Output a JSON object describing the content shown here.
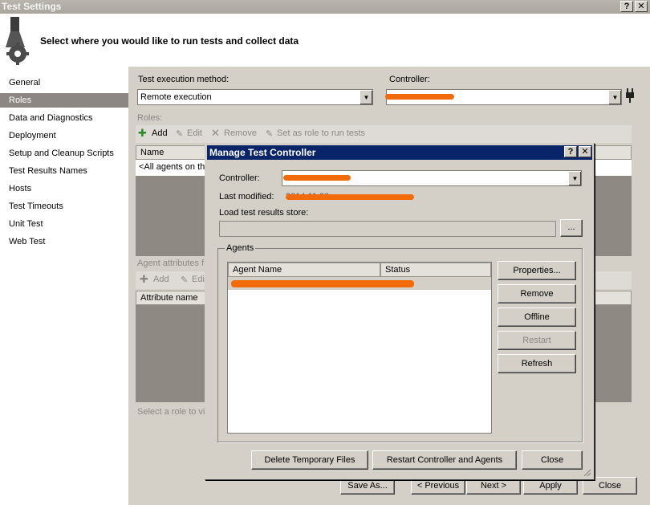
{
  "window": {
    "title": "Test Settings",
    "help_btn": "?",
    "close_btn": "✕",
    "header_text": "Select where you would like to run tests and collect data"
  },
  "sidebar": {
    "items": [
      {
        "label": "General"
      },
      {
        "label": "Roles"
      },
      {
        "label": "Data and Diagnostics"
      },
      {
        "label": "Deployment"
      },
      {
        "label": "Setup and Cleanup Scripts"
      },
      {
        "label": "Test Results Names"
      },
      {
        "label": "Hosts"
      },
      {
        "label": "Test Timeouts"
      },
      {
        "label": "Unit Test"
      },
      {
        "label": "Web Test"
      }
    ],
    "selected": "Roles"
  },
  "main": {
    "exec_method_label": "Test execution method:",
    "exec_method_value": "Remote execution",
    "controller_label": "Controller:",
    "controller_value": "",
    "roles_label": "Roles:",
    "roles_toolbar": {
      "add": "Add",
      "edit": "Edit",
      "remove": "Remove",
      "set_role": "Set as role to run tests"
    },
    "roles_grid_header": "Name",
    "roles_row": "<All agents on th",
    "agent_attr_label": "Agent attributes f",
    "attr_toolbar": {
      "add": "Add",
      "edit": "Edi"
    },
    "attr_grid_header": "Attribute name",
    "hint": "Select a role to vi"
  },
  "footer": {
    "save_as": "Save As...",
    "previous": "< Previous",
    "next": "Next >",
    "apply": "Apply",
    "close": "Close"
  },
  "dialog": {
    "title": "Manage Test Controller",
    "help_btn": "?",
    "close_btn": "✕",
    "controller_label": "Controller:",
    "last_modified_label": "Last modified:",
    "last_modified_value": "2014 11:30",
    "load_store_label": "Load test results store:",
    "browse_btn": "...",
    "agents_group": "Agents",
    "agent_columns": [
      "Agent Name",
      "Status"
    ],
    "buttons": {
      "properties": "Properties...",
      "remove": "Remove",
      "offline": "Offline",
      "restart": "Restart",
      "refresh": "Refresh",
      "delete_temp": "Delete Temporary Files",
      "restart_all": "Restart Controller and Agents",
      "close": "Close"
    }
  },
  "colors": {
    "accent": "#0a246a",
    "selection": "#8c8782",
    "redaction": "#f26b0a"
  }
}
